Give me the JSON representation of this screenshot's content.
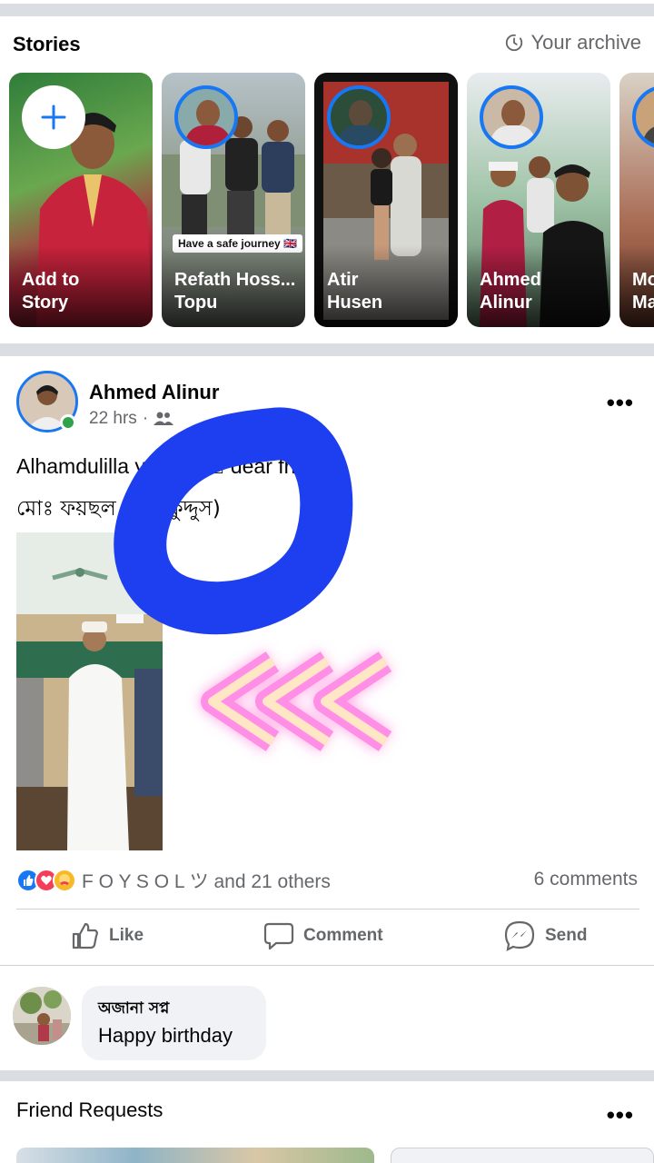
{
  "stories": {
    "title": "Stories",
    "archive_label": "Your archive",
    "items": [
      {
        "line1": "Add to",
        "line2": "Story"
      },
      {
        "line1": "Refath Hoss...",
        "line2": "Topu",
        "badge": "Have a safe journey 🇬🇧"
      },
      {
        "line1": "Atir",
        "line2": "Husen"
      },
      {
        "line1": "Ahmed",
        "line2": "Alinur"
      },
      {
        "line1": "Mo",
        "line2": "Ma"
      }
    ]
  },
  "post": {
    "author": "Ahmed Alinur",
    "time": "22 hrs",
    "text_line1": "Alhamdulilla       y birthd        🏻 dear friend",
    "text_line2": "মোঃ ফয়ছল         মেদ (কুদ্দুস)",
    "reactions_text": "F O Y S O L ツ and 21 others",
    "comments_count": "6 comments",
    "actions": {
      "like": "Like",
      "comment": "Comment",
      "send": "Send"
    },
    "more_icon": "•••"
  },
  "comment": {
    "author": "অজানা সপ্ন",
    "text": "Happy birthday"
  },
  "friend_requests": {
    "title": "Friend Requests",
    "more_icon": "•••"
  },
  "colors": {
    "accent": "#1877f2",
    "online": "#31a24c",
    "secondary_text": "#65676b",
    "marker_blue": "#1e3ff0",
    "neon_pink": "#ff7ee0"
  }
}
